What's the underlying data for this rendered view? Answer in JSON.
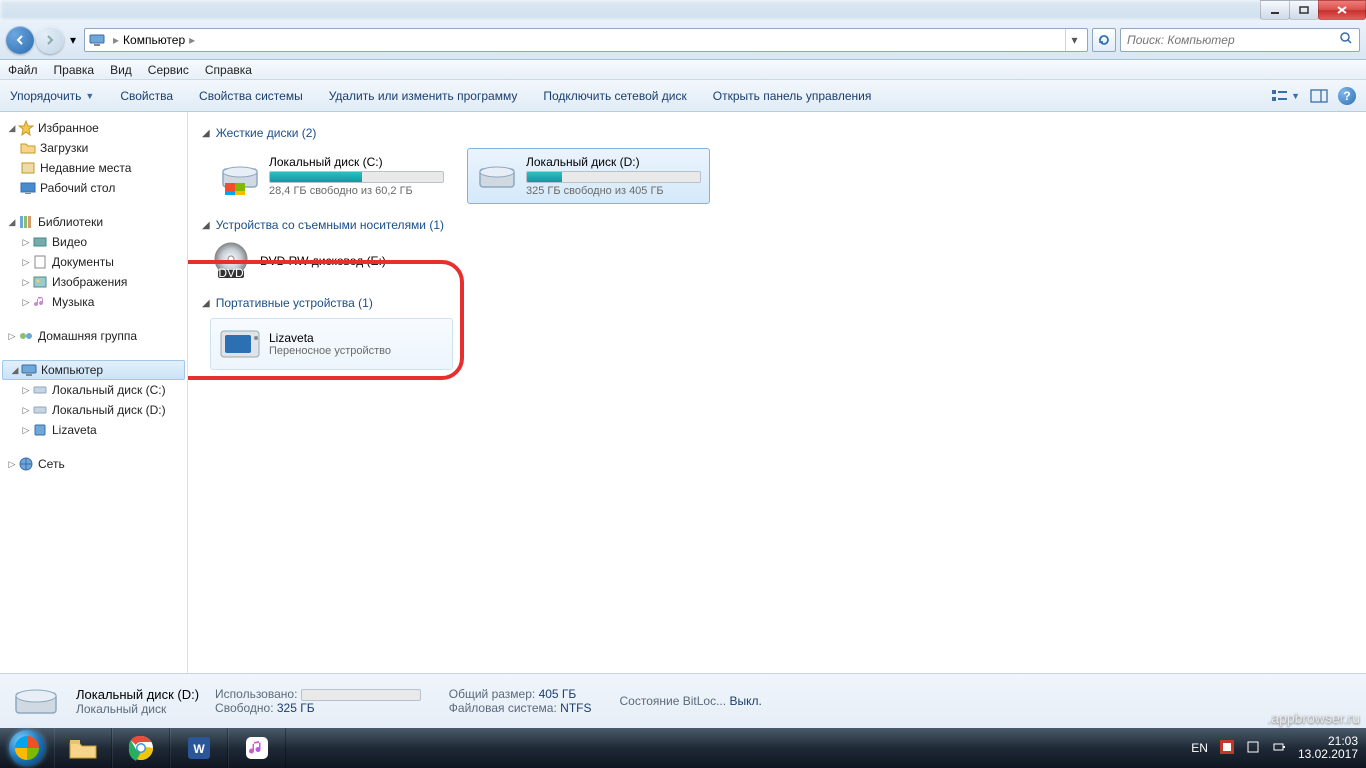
{
  "window": {
    "breadcrumb_root": "Компьютер",
    "search_placeholder": "Поиск: Компьютер"
  },
  "menu": {
    "file": "Файл",
    "edit": "Правка",
    "view": "Вид",
    "service": "Сервис",
    "help": "Справка"
  },
  "toolbar": {
    "organize": "Упорядочить",
    "properties": "Свойства",
    "system_properties": "Свойства системы",
    "uninstall": "Удалить или изменить программу",
    "map_drive": "Подключить сетевой диск",
    "control_panel": "Открыть панель управления"
  },
  "sidebar": {
    "favorites": "Избранное",
    "downloads": "Загрузки",
    "recent": "Недавние места",
    "desktop": "Рабочий стол",
    "libraries": "Библиотеки",
    "videos": "Видео",
    "documents": "Документы",
    "pictures": "Изображения",
    "music": "Музыка",
    "homegroup": "Домашняя группа",
    "computer": "Компьютер",
    "drive_c": "Локальный диск (C:)",
    "drive_d": "Локальный диск (D:)",
    "lizaveta": "Lizaveta",
    "network": "Сеть"
  },
  "sections": {
    "hard_disks": "Жесткие диски (2)",
    "removable": "Устройства со съемными носителями (1)",
    "portable": "Портативные устройства (1)"
  },
  "drives": {
    "c": {
      "name": "Локальный диск (C:)",
      "free": "28,4 ГБ свободно из 60,2 ГБ",
      "fill": 53
    },
    "d": {
      "name": "Локальный диск (D:)",
      "free": "325 ГБ свободно из 405 ГБ",
      "fill": 20
    },
    "dvd": {
      "name": "DVD RW дисковод (E:)"
    },
    "portable": {
      "name": "Lizaveta",
      "sub": "Переносное устройство"
    }
  },
  "details": {
    "title": "Локальный диск (D:)",
    "subtitle": "Локальный диск",
    "used_label": "Использовано:",
    "free_label": "Свободно:",
    "free_val": "325 ГБ",
    "total_label": "Общий размер:",
    "total_val": "405 ГБ",
    "fs_label": "Файловая система:",
    "fs_val": "NTFS",
    "bitlocker_label": "Состояние BitLoc...",
    "bitlocker_val": "Выкл."
  },
  "tray": {
    "lang": "EN",
    "time": "21:03",
    "date": "13.02.2017"
  },
  "watermark": ".appbrowser.ru"
}
